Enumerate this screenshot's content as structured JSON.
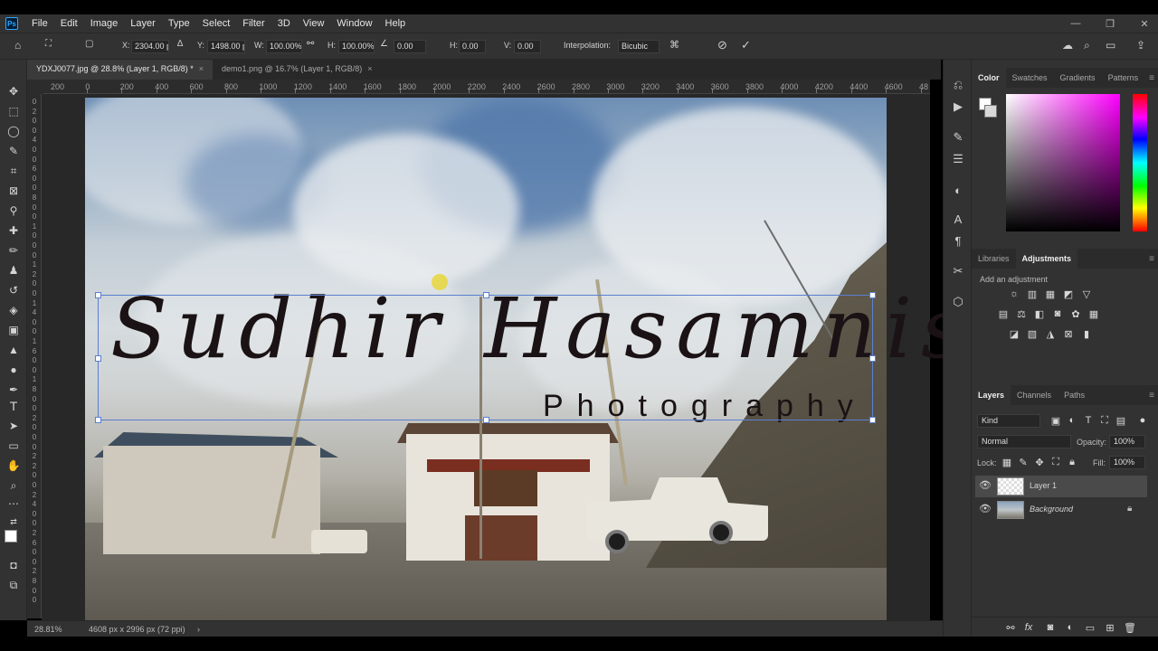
{
  "app": {
    "logo": "Ps"
  },
  "menu": [
    "File",
    "Edit",
    "Image",
    "Layer",
    "Type",
    "Select",
    "Filter",
    "3D",
    "View",
    "Window",
    "Help"
  ],
  "window_controls": [
    "—",
    "❐",
    "✕"
  ],
  "options": {
    "x_label": "X:",
    "x_value": "2304.00 p",
    "y_label": "Y:",
    "y_value": "1498.00 p",
    "w_label": "W:",
    "w_value": "100.00%",
    "h_label": "H:",
    "h_value": "100.00%",
    "angle_value": "0.00",
    "hskew_label": "H:",
    "hskew_value": "0.00",
    "vskew_label": "V:",
    "vskew_value": "0.00",
    "interp_label": "Interpolation:",
    "interp_value": "Bicubic",
    "cancel_icon": "⊘",
    "commit_icon": "✓"
  },
  "tabs": [
    {
      "label": "YDXJ0077.jpg @ 28.8% (Layer 1, RGB/8) *",
      "close": "×"
    },
    {
      "label": "demo1.png @ 16.7% (Layer 1, RGB/8)",
      "close": "×"
    }
  ],
  "ruler_h": [
    "200",
    "0",
    "200",
    "400",
    "600",
    "800",
    "1000",
    "1200",
    "1400",
    "1600",
    "1800",
    "2000",
    "2200",
    "2400",
    "2600",
    "2800",
    "3000",
    "3200",
    "3400",
    "3600",
    "3800",
    "4000",
    "4200",
    "4400",
    "4600",
    "48"
  ],
  "ruler_v": [
    "0",
    "2",
    "0",
    "0",
    "4",
    "0",
    "0",
    "6",
    "0",
    "0",
    "8",
    "0",
    "0",
    "1",
    "0",
    "0",
    "0",
    "1",
    "2",
    "0",
    "0",
    "1",
    "4",
    "0",
    "0",
    "1",
    "6",
    "0",
    "0",
    "1",
    "8",
    "0",
    "0",
    "2",
    "0",
    "0",
    "0",
    "2",
    "2",
    "0",
    "0",
    "2",
    "4",
    "0",
    "0",
    "2",
    "6",
    "0",
    "0",
    "2",
    "8",
    "0",
    "0"
  ],
  "canvas_text": {
    "main": "Sudhir Hasamnis",
    "sub": "Photography"
  },
  "status": {
    "zoom": "28.81%",
    "doc": "4608 px x 2996 px (72 ppi)",
    "arrow": "›"
  },
  "panels": {
    "color_tabs": [
      "Color",
      "Swatches",
      "Gradients",
      "Patterns"
    ],
    "lib_tabs": [
      "Libraries",
      "Adjustments"
    ],
    "add_adjustment": "Add an adjustment",
    "layers_tabs": [
      "Layers",
      "Channels",
      "Paths"
    ],
    "kind": "Kind",
    "blend": "Normal",
    "opacity_label": "Opacity:",
    "opacity_value": "100%",
    "lock_label": "Lock:",
    "fill_label": "Fill:",
    "fill_value": "100%",
    "layers": [
      {
        "name": "Layer 1",
        "selected": true
      },
      {
        "name": "Background",
        "selected": false
      }
    ]
  },
  "colors": {
    "fg": "#ffffff",
    "bg": "#d9d9d9",
    "selection": "#5b7fd0"
  }
}
